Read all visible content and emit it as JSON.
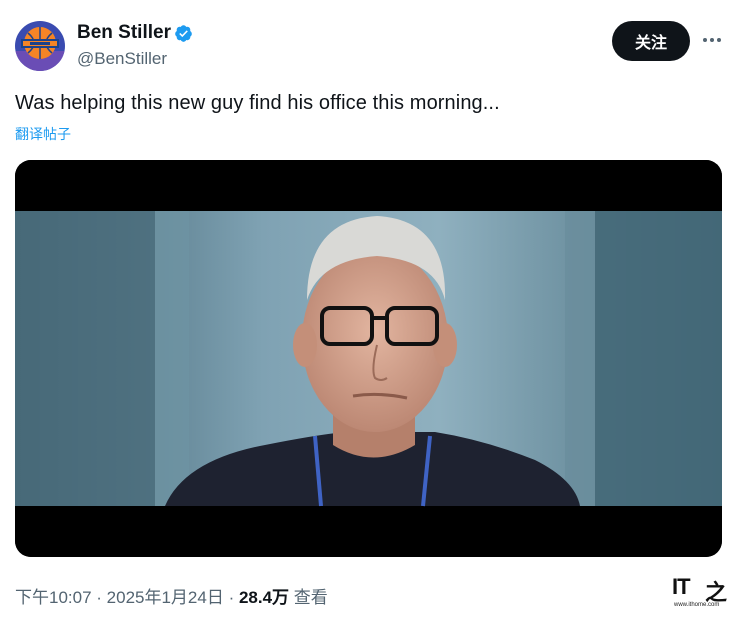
{
  "author": {
    "name": "Ben Stiller",
    "handle": "@BenStiller",
    "avatar_icon": "knicks-logo-icon",
    "verified_icon": "verified-badge-icon",
    "verified_color": "#1d9bf0"
  },
  "actions": {
    "follow_label": "关注",
    "more_icon": "more-horizontal-icon"
  },
  "tweet": {
    "text": "Was helping this new guy find his office this morning...",
    "translate_label": "翻译帖子",
    "media_type": "video-still"
  },
  "meta": {
    "time": "下午10:07",
    "sep1": " · ",
    "date": "2025年1月24日",
    "sep2": " · ",
    "views_count": "28.4万",
    "views_label": " 查看"
  },
  "watermark": {
    "logo": "IT",
    "logo_zh": "之",
    "url": "www.ithome.com"
  },
  "colors": {
    "text_primary": "#0f1419",
    "text_secondary": "#536471",
    "link": "#1d9bf0",
    "button_bg": "#0f1419"
  }
}
